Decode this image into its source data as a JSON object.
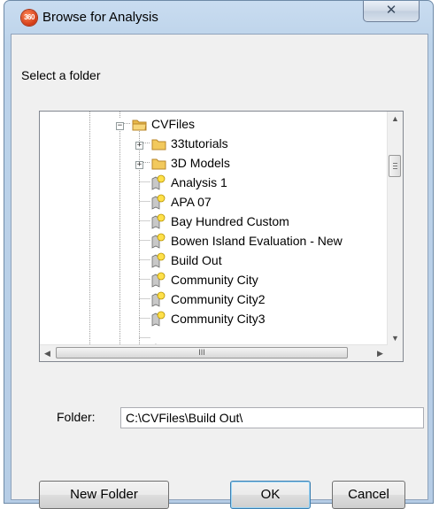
{
  "window": {
    "title": "Browse for Analysis",
    "close_glyph": "✕",
    "app_icon_text": "360"
  },
  "prompt": "Select a folder",
  "tree": {
    "root": {
      "label": "CVFiles",
      "expander": "−"
    },
    "folders": [
      {
        "label": "33tutorials",
        "expander": "+"
      },
      {
        "label": "3D Models",
        "expander": "+"
      }
    ],
    "analyses": [
      "Analysis 1",
      "APA 07",
      "Bay Hundred Custom",
      "Bowen Island Evaluation - New",
      "Build Out",
      "Community City",
      "Community City2",
      "Community City3"
    ]
  },
  "scrollbars": {
    "up_arrow": "▲",
    "down_arrow": "▼",
    "left_arrow": "◀",
    "right_arrow": "▶",
    "hthumb_grip": "III"
  },
  "folder_field": {
    "label": "Folder:",
    "value": "C:\\CVFiles\\Build Out\\"
  },
  "buttons": {
    "new_folder": "New Folder",
    "ok": "OK",
    "cancel": "Cancel"
  }
}
